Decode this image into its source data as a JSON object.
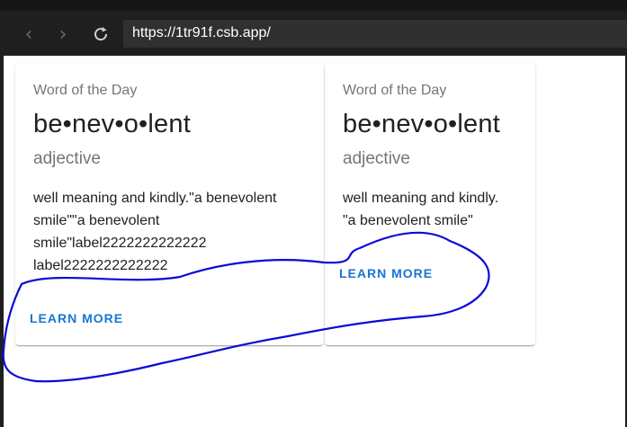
{
  "browser": {
    "url": "https://1tr91f.csb.app/",
    "back_icon": "chevron-left-icon",
    "forward_icon": "chevron-right-icon",
    "reload_icon": "reload-icon"
  },
  "cards": [
    {
      "overline": "Word of the Day",
      "word": "be•nev•o•lent",
      "part_of_speech": "adjective",
      "definition_lines": [
        "well meaning and kindly.\"a benevolent",
        "smile\"\"a benevolent",
        "smile\"label2222222222222",
        "label2222222222222"
      ],
      "action_label": "LEARN MORE"
    },
    {
      "overline": "Word of the Day",
      "word": "be•nev•o•lent",
      "part_of_speech": "adjective",
      "definition_lines": [
        "well meaning and kindly.",
        "\"a benevolent smile\""
      ],
      "action_label": "LEARN MORE"
    }
  ],
  "colors": {
    "accent": "#1976d2",
    "annotation_ink": "#0a0ad6",
    "chrome": "#1f1f1f"
  }
}
